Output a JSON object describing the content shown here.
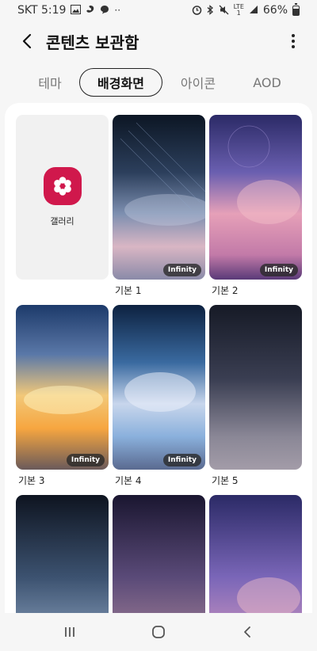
{
  "status": {
    "carrier_time": "SKT 5:19",
    "dots": "··",
    "lte_top": "LTE",
    "lte_bottom": "1",
    "battery_text": "66%",
    "battery_level": 0.66
  },
  "header": {
    "title": "콘텐츠 보관함"
  },
  "tabs": [
    "테마",
    "배경화면",
    "아이콘",
    "AOD"
  ],
  "active_tab": "배경화면",
  "gallery": {
    "label": "갤러리"
  },
  "wallpapers": [
    {
      "label": "기본 1",
      "badge": "Infinity"
    },
    {
      "label": "기본 2",
      "badge": "Infinity"
    },
    {
      "label": "기본 3",
      "badge": "Infinity"
    },
    {
      "label": "기본 4",
      "badge": "Infinity"
    },
    {
      "label": "기본 5",
      "badge": ""
    },
    {
      "label": "",
      "badge": ""
    },
    {
      "label": "",
      "badge": ""
    },
    {
      "label": "",
      "badge": ""
    }
  ],
  "colors": {
    "gallery_icon": "#d0184c",
    "accent_dark": "#222222"
  }
}
